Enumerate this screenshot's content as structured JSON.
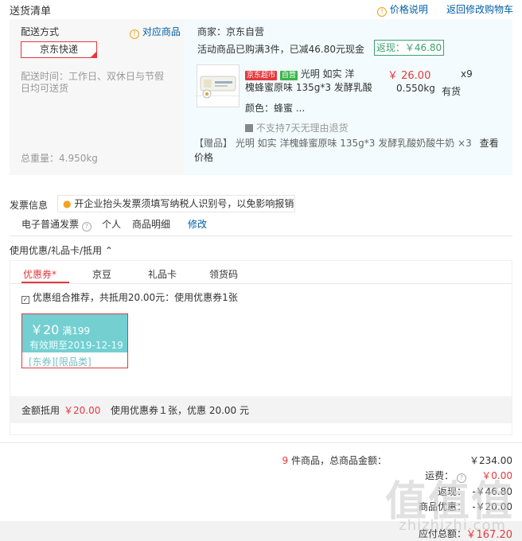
{
  "header": {
    "title": "送货清单",
    "price_link": "价格说明",
    "back_link": "返回修改购物车"
  },
  "delivery": {
    "method_label": "配送方式",
    "match_link": "对应商品",
    "method_value": "京东快递",
    "time_label": "配送时间：工作日、双休日与节假日均可送货",
    "weight_label": "总重量：4.950kg"
  },
  "shop": {
    "merchant": "商家：京东自营",
    "promo": "活动商品已购满3件，已减46.80元现金",
    "rebate": "返现：￥46.80",
    "item": {
      "tag_supermarket": "京东超市",
      "tag_green": "自营",
      "name_line1": "光明 如实 洋",
      "name_line2": "槐蜂蜜原味 135g*3 发酵乳酸",
      "price": "￥ 26.00",
      "qty": "x9",
      "weight": "0.550kg",
      "stock": "有货",
      "attr": "颜色：蜂蜜 ...",
      "no_return": "不支持7天无理由退货"
    },
    "gift": "【赠品】 光明 如实 洋槐蜂蜜原味 135g*3 发酵乳酸奶酸牛奶 ×3",
    "gift_link1": "查看",
    "gift_link2": "价格"
  },
  "invoice": {
    "label": "发票信息",
    "tip": "开企业抬头发票须填写纳税人识别号，以免影响报销",
    "type": "电子普通发票",
    "personal": "个人",
    "detail": "商品明细",
    "edit": "修改"
  },
  "coupons": {
    "section_label": "使用优惠/礼品卡/抵用",
    "tabs": [
      "优惠券*",
      "京豆",
      "礼品卡",
      "领货码"
    ],
    "recommend": "优惠组合推荐，共抵用20.00元：使用优惠券1张",
    "coupon": {
      "amount": "￥20",
      "condition": "满199",
      "validity": "有效期至2019-12-19",
      "tag1": "[东券]",
      "tag2": "[限品类]"
    },
    "amount_label": "金额抵用",
    "amount_value": "￥20.00",
    "amount_desc": "使用优惠券１张，优惠 20.00 元"
  },
  "totals": {
    "count": "9",
    "count_suffix": "件商品，总商品金额：",
    "goods_total": "￥234.00",
    "shipping_label": "运费：",
    "shipping_value": "￥0.00",
    "rebate_label": "返现：",
    "rebate_value": "-￥46.80",
    "coupon_label": "商品优惠：",
    "coupon_value": "-￥20.00",
    "payable_label": "应付总额：",
    "payable_value": "￥167.20"
  },
  "watermark": {
    "main": "值值值",
    "sub": "zhizhizhi.com"
  },
  "colors": {
    "accent": "#e4393c",
    "link": "#005ea7",
    "coupon": "#74cfd1",
    "rebate": "#3aa26e"
  }
}
